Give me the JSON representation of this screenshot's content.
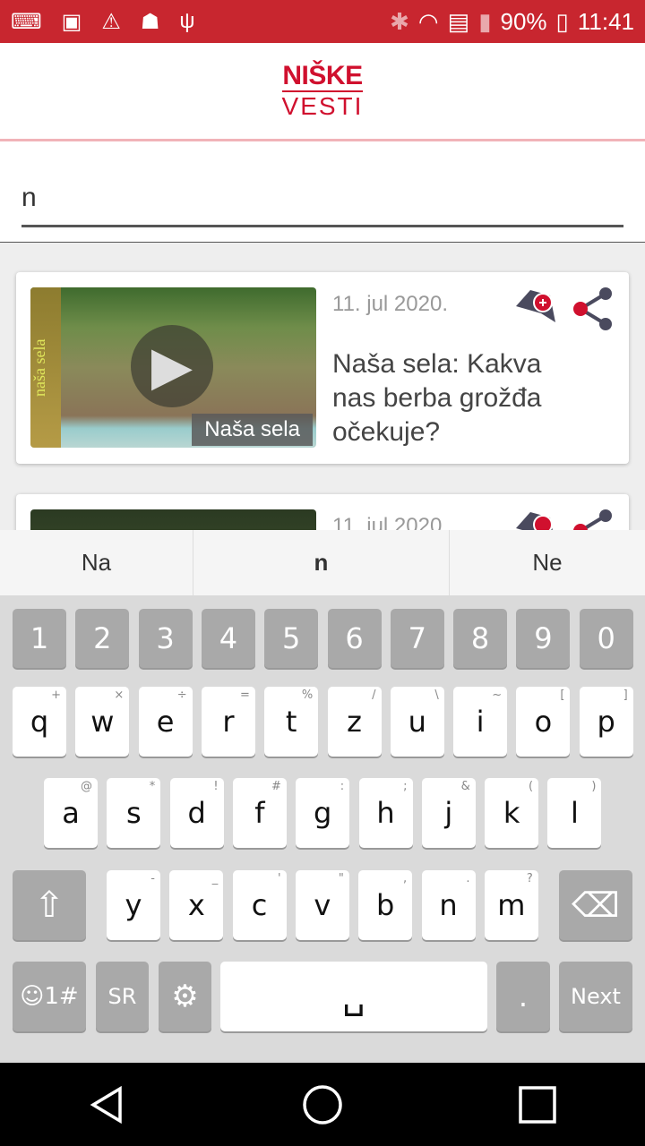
{
  "status_bar": {
    "left_icons": [
      "keyboard-icon",
      "image-icon",
      "warning-icon",
      "android-debug-icon",
      "usb-icon"
    ],
    "right_icons": [
      "bluetooth-icon",
      "wifi-icon",
      "sd-card-icon",
      "signal-icon"
    ],
    "battery": "90%",
    "time": "11:41"
  },
  "header": {
    "logo_line1": "NIŠKE",
    "logo_line2": "VESTI",
    "brand_color": "#d0102e"
  },
  "search": {
    "value": "n"
  },
  "articles": [
    {
      "date": "11. jul 2020.",
      "title": "Naša sela: Kakva nas berba grožđa očekuje?",
      "thumb_tag": "Naša sela",
      "thumb_side": "naša sela"
    },
    {
      "date": "11. jul 2020.",
      "title": ""
    }
  ],
  "suggestions": [
    "Na",
    "n",
    "Ne"
  ],
  "keyboard": {
    "numbers": [
      "1",
      "2",
      "3",
      "4",
      "5",
      "6",
      "7",
      "8",
      "9",
      "0"
    ],
    "row1": [
      [
        "q",
        "+"
      ],
      [
        "w",
        "×"
      ],
      [
        "e",
        "÷"
      ],
      [
        "r",
        "="
      ],
      [
        "t",
        "%"
      ],
      [
        "z",
        "/"
      ],
      [
        "u",
        "\\"
      ],
      [
        "i",
        "~"
      ],
      [
        "o",
        "["
      ],
      [
        "p",
        "]"
      ]
    ],
    "row2": [
      [
        "a",
        "@"
      ],
      [
        "s",
        "*"
      ],
      [
        "d",
        "!"
      ],
      [
        "f",
        "#"
      ],
      [
        "g",
        ":"
      ],
      [
        "h",
        ";"
      ],
      [
        "j",
        "&"
      ],
      [
        "k",
        "("
      ],
      [
        "l",
        ")"
      ]
    ],
    "row3": [
      [
        "y",
        "-"
      ],
      [
        "x",
        "_"
      ],
      [
        "c",
        "'"
      ],
      [
        "v",
        "\""
      ],
      [
        "b",
        ","
      ],
      [
        "n",
        "."
      ],
      [
        "m",
        "?"
      ]
    ],
    "emoji_key": "☺1#",
    "lang_key": "SR",
    "period_key": ".",
    "next_key": "Next"
  }
}
